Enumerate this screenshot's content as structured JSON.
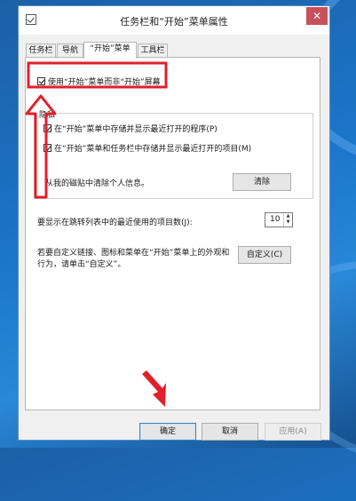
{
  "window": {
    "title": "任务栏和“开始”菜单属性",
    "close_symbol": "✕"
  },
  "tabs": [
    {
      "label": "任务栏"
    },
    {
      "label": "导航"
    },
    {
      "label": "“开始”菜单"
    },
    {
      "label": "工具栏"
    }
  ],
  "start": {
    "use_start_menu_label": "使用“开始”菜单而非“开始”屏幕",
    "use_start_menu_checked": true
  },
  "privacy": {
    "group_label": "隐私",
    "store_programs_label": "在“开始”菜单中存储并显示最近打开的程序(P)",
    "store_items_label": "在“开始”菜单和任务栏中存储并显示最近打开的项目(M)",
    "clear_desc": "从我的磁贴中清除个人信息。",
    "clear_button": "清除"
  },
  "jumplist": {
    "label": "要显示在跳转列表中的最近使用的项目数(J):",
    "value": "10"
  },
  "customize": {
    "desc_line1": "若要自定义链接、图标和菜单在“开始”菜单上的外观和",
    "desc_line2": "行为，请单击“自定义”。",
    "button": "自定义(C)"
  },
  "footer": {
    "ok": "确定",
    "cancel": "取消",
    "apply": "应用(A)"
  },
  "colors": {
    "annotation_red": "#e0202a",
    "desktop_blue": "#1b75c9"
  }
}
